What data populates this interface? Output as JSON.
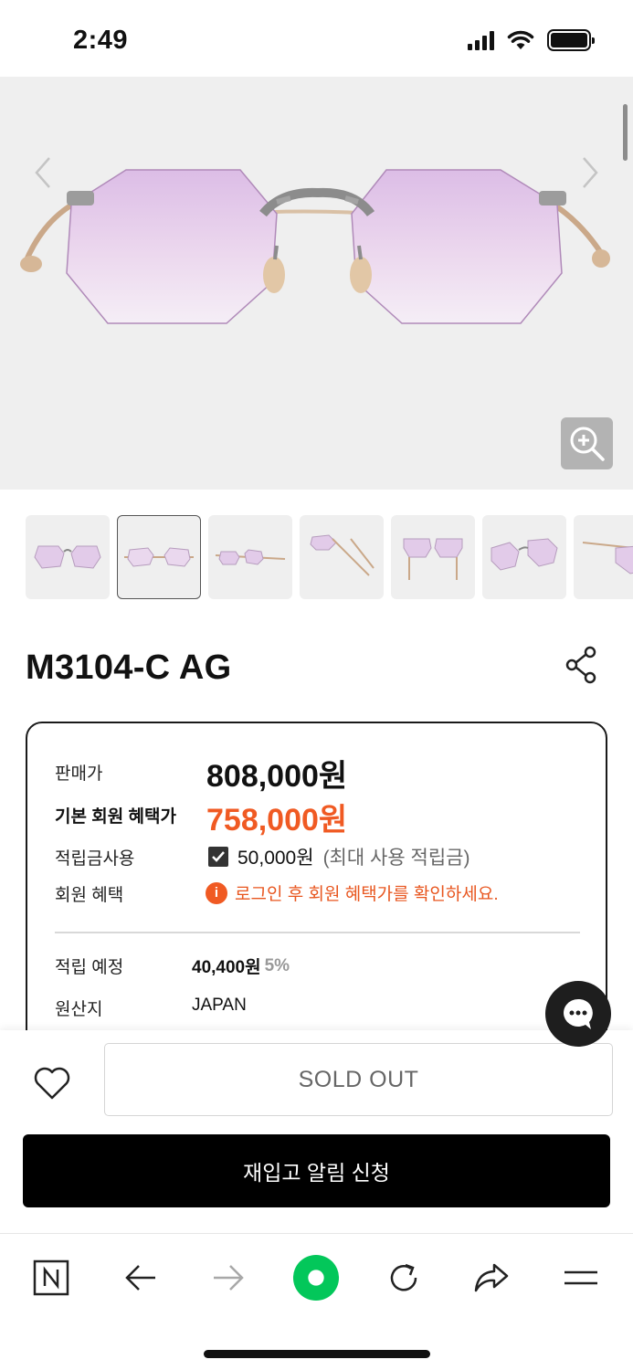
{
  "status_bar": {
    "time": "2:49",
    "icons": [
      "cellular-signal-icon",
      "wifi-icon",
      "battery-icon"
    ]
  },
  "gallery": {
    "icons": [
      "chevron-left-icon",
      "chevron-right-icon",
      "zoom-in-icon"
    ],
    "thumbnail_count": 7,
    "active_thumbnail_index": 1,
    "lens_color": "#e6c8ea",
    "frame_color": "#c7a98a"
  },
  "product": {
    "title": "M3104-C AG",
    "share_icon": "share-icon"
  },
  "price": {
    "sale_label": "판매가",
    "sale_value": "808,000원",
    "member_label": "기본 회원 혜택가",
    "member_value": "758,000원",
    "points_use_label": "적립금사용",
    "points_use_value": "50,000원",
    "points_use_note": "(최대 사용 적립금)",
    "points_use_checked": true,
    "benefit_label": "회원 혜택",
    "benefit_notice": "로그인 후 회원 혜택가를 확인하세요.",
    "accrual_label": "적립 예정",
    "accrual_value": "40,400원",
    "accrual_rate": "5%",
    "origin_label": "원산지",
    "origin_value": "JAPAN",
    "accent_color": "#f05a23"
  },
  "actions": {
    "wishlist_icon": "heart-outline-icon",
    "sold_out_label": "SOLD OUT",
    "restock_label": "재입고 알림 신청",
    "chat_icon": "chat-bubble-icon"
  },
  "browser_toolbar": {
    "items": [
      "naver-home-icon",
      "back-arrow-icon",
      "forward-arrow-icon",
      "green-dot-icon",
      "reload-icon",
      "share-arrow-icon",
      "menu-icon"
    ],
    "green_dot_color": "#03c75a"
  }
}
